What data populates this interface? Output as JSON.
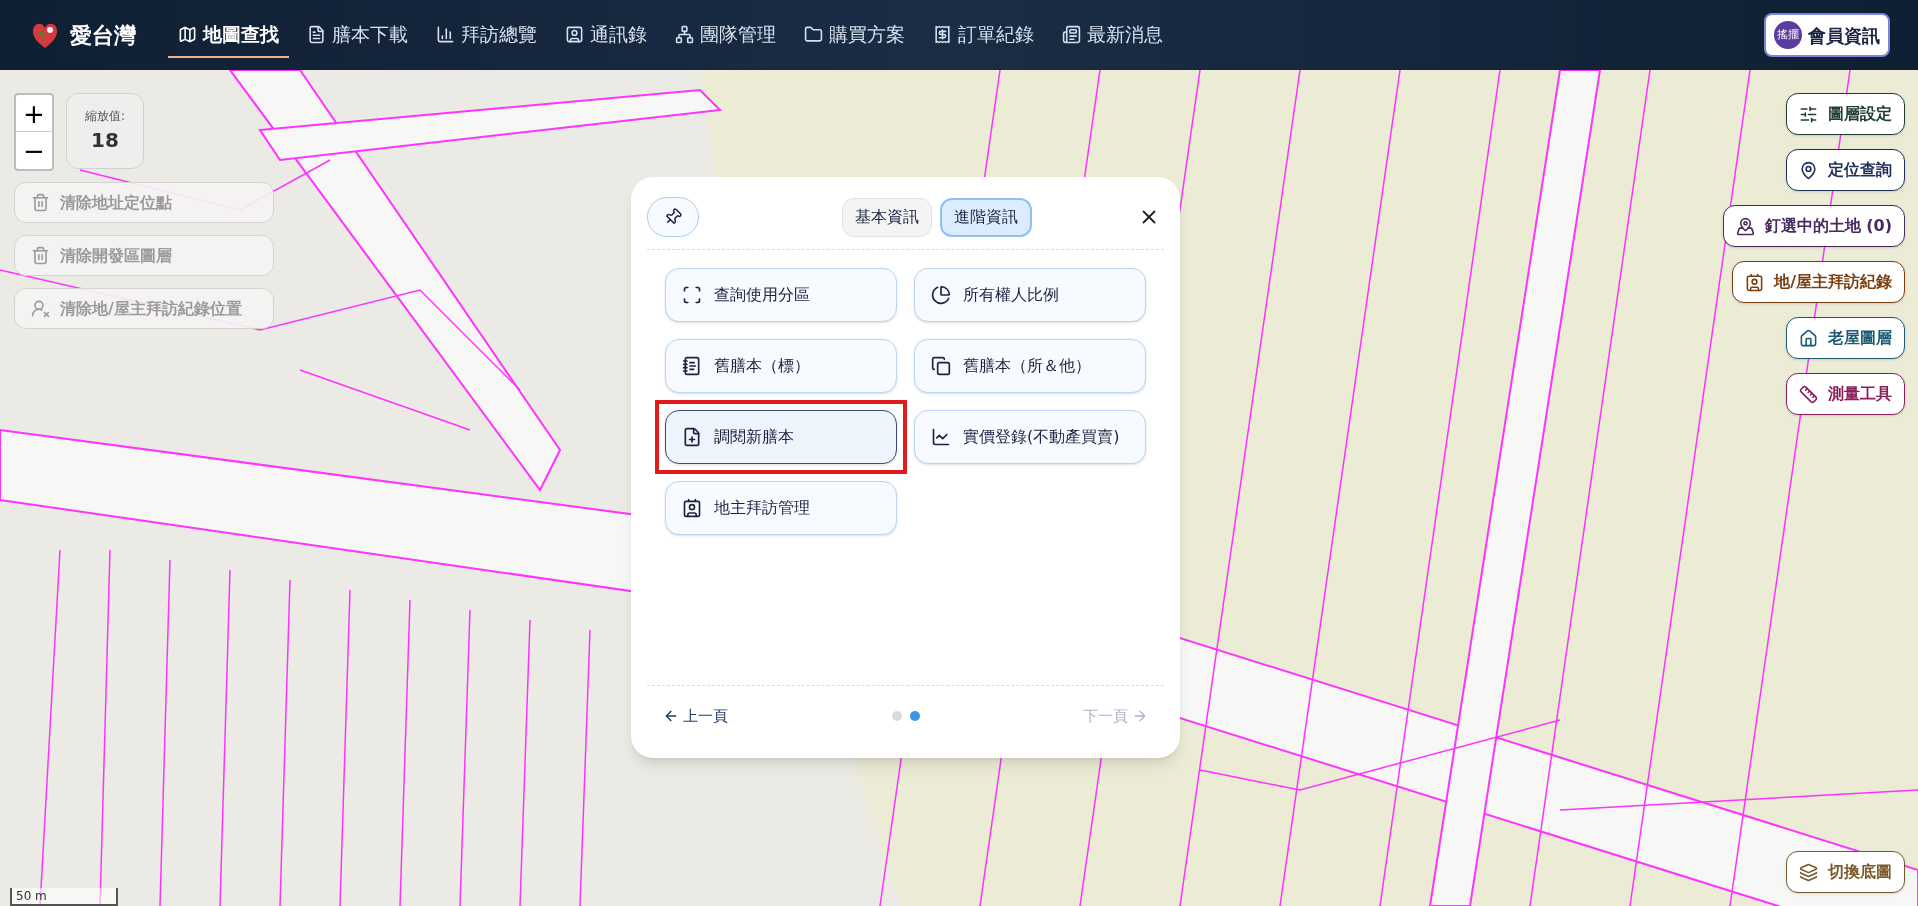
{
  "app": {
    "name": "愛台灣"
  },
  "nav": [
    {
      "label": "地圖查找",
      "selected": true
    },
    {
      "label": "膳本下載",
      "selected": false
    },
    {
      "label": "拜訪總覽",
      "selected": false
    },
    {
      "label": "通訊錄",
      "selected": false
    },
    {
      "label": "團隊管理",
      "selected": false
    },
    {
      "label": "購買方案",
      "selected": false
    },
    {
      "label": "訂單紀錄",
      "selected": false
    },
    {
      "label": "最新消息",
      "selected": false
    }
  ],
  "account_button": {
    "badge": "搖擺",
    "label": "會員資訊"
  },
  "zoom": {
    "zoom_in": "+",
    "zoom_out": "−",
    "label": "縮放值:",
    "value": "18"
  },
  "clear_actions": [
    {
      "label": "清除地址定位點",
      "disabled": true
    },
    {
      "label": "清除開發區圖層",
      "disabled": true
    },
    {
      "label": "清除地/屋主拜訪紀錄位置",
      "disabled": true
    }
  ],
  "modal": {
    "tabs": [
      {
        "label": "基本資訊",
        "selected": false
      },
      {
        "label": "進階資訊",
        "selected": true
      }
    ],
    "actions": [
      {
        "label": "查詢使用分區",
        "focused": false
      },
      {
        "label": "所有權人比例",
        "focused": false
      },
      {
        "label": "舊膳本（標）",
        "focused": false
      },
      {
        "label": "舊膳本（所＆他）",
        "focused": false
      },
      {
        "label": "調閱新膳本",
        "focused": true
      },
      {
        "label": "實價登錄(不動產買賣)",
        "focused": false
      },
      {
        "label": "地主拜訪管理",
        "focused": false
      }
    ],
    "prev": {
      "label": "上一頁",
      "disabled": false
    },
    "pages": [
      {
        "selected": false
      },
      {
        "selected": true
      }
    ],
    "next": {
      "label": "下一頁",
      "disabled": true
    }
  },
  "right_tools": [
    {
      "label": "圖層設定",
      "color": "#1f3d33"
    },
    {
      "label": "定位查詢",
      "color": "#1e2f5c"
    },
    {
      "label": "釘選中的土地 (0)",
      "color": "#4a2a5e"
    },
    {
      "label": "地/屋主拜訪紀錄",
      "color": "#7a3f10"
    },
    {
      "label": "老屋圖層",
      "color": "#1b5a72"
    },
    {
      "label": "測量工具",
      "color": "#8a1f5a"
    }
  ],
  "base_map_button": {
    "label": "切換底圖"
  },
  "scale": {
    "label": "50 m"
  }
}
